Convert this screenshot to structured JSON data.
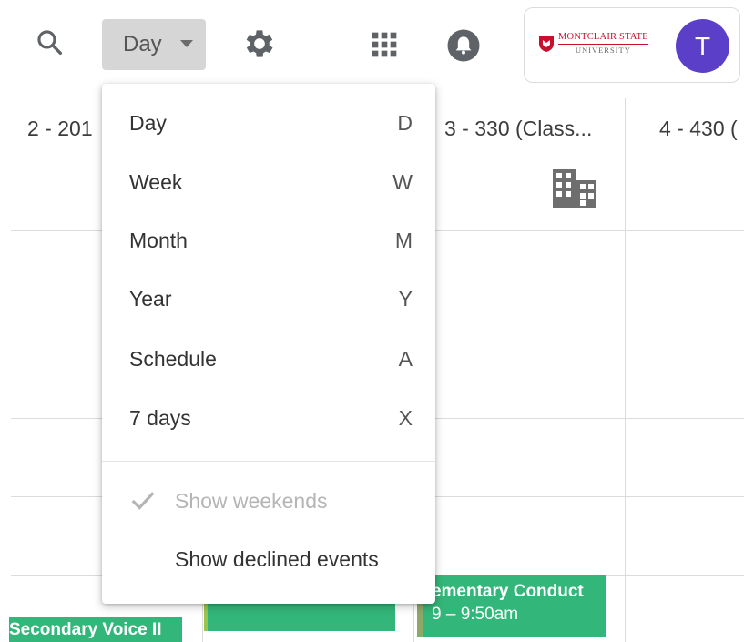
{
  "toolbar": {
    "view_label": "Day",
    "search_icon": "search-icon",
    "settings_icon": "gear-icon",
    "apps_icon": "apps-grid-icon",
    "notifications_icon": "bell-icon"
  },
  "account": {
    "logo_top": "MONTCLAIR STATE",
    "logo_bottom": "UNIVERSITY",
    "avatar_initial": "T",
    "avatar_color": "#5b3fc9",
    "brand_color": "#c8102e"
  },
  "columns": [
    {
      "label": "2 - 201"
    },
    {
      "label": "3 - 330 (Class..."
    },
    {
      "label": "4 - 430 ("
    }
  ],
  "events": [
    {
      "title": "Secondary Voice II"
    },
    {
      "title": ""
    },
    {
      "title": "Elementary Conduct",
      "time": "9 – 9:50am"
    }
  ],
  "event_color": "#33b679",
  "menu": {
    "items": [
      {
        "label": "Day",
        "key": "D"
      },
      {
        "label": "Week",
        "key": "W"
      },
      {
        "label": "Month",
        "key": "M"
      },
      {
        "label": "Year",
        "key": "Y"
      },
      {
        "label": "Schedule",
        "key": "A"
      },
      {
        "label": "7 days",
        "key": "X"
      }
    ],
    "options": [
      {
        "label": "Show weekends",
        "checked": true,
        "disabled": true
      },
      {
        "label": "Show declined events",
        "checked": false,
        "disabled": false
      }
    ]
  }
}
